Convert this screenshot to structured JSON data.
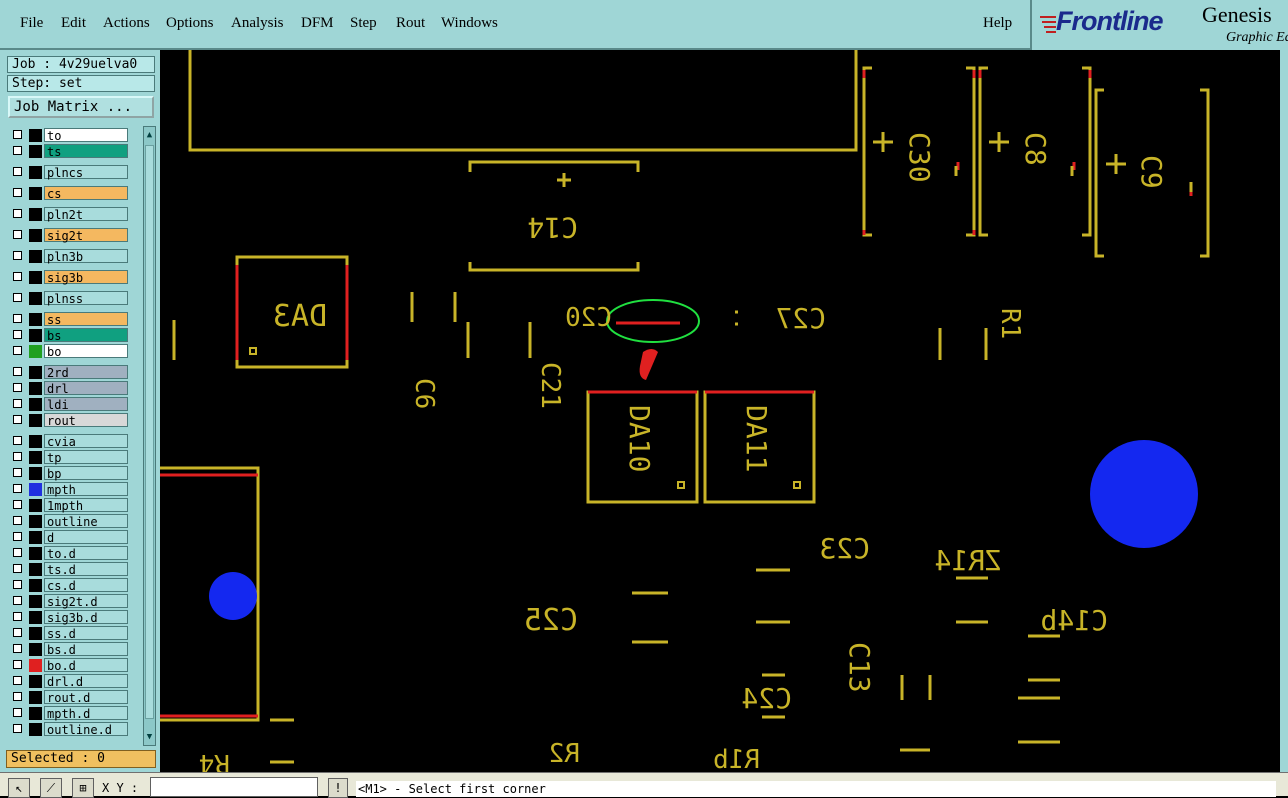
{
  "menu": [
    "File",
    "Edit",
    "Actions",
    "Options",
    "Analysis",
    "DFM",
    "Step",
    "Rout",
    "Windows"
  ],
  "help": "Help",
  "brand": {
    "logo": "Frontline",
    "product": "Genesis",
    "sub": "Graphic Ed"
  },
  "job": "Job : 4v29uelva0",
  "step": "Step: set",
  "job_matrix": "Job Matrix ...",
  "layers": [
    {
      "name": "to",
      "bg": "#ffffff",
      "swatch": "#000000"
    },
    {
      "name": "ts",
      "bg": "#10a080",
      "swatch": "#000000"
    },
    {
      "name": "plncs",
      "bg": "#a8dcdc",
      "swatch": "#000000"
    },
    {
      "name": "cs",
      "bg": "#f4b860",
      "swatch": "#000000"
    },
    {
      "name": "pln2t",
      "bg": "#a8dcdc",
      "swatch": "#000000"
    },
    {
      "name": "sig2t",
      "bg": "#f4b860",
      "swatch": "#000000"
    },
    {
      "name": "pln3b",
      "bg": "#a8dcdc",
      "swatch": "#000000"
    },
    {
      "name": "sig3b",
      "bg": "#f4b860",
      "swatch": "#000000"
    },
    {
      "name": "plnss",
      "bg": "#a8dcdc",
      "swatch": "#000000"
    },
    {
      "name": "ss",
      "bg": "#f4b860",
      "swatch": "#000000"
    },
    {
      "name": "bs",
      "bg": "#10a080",
      "swatch": "#000000"
    },
    {
      "name": "bo",
      "bg": "#ffffff",
      "swatch": "#20a020"
    },
    {
      "name": "2rd",
      "bg": "#a0b0c0",
      "swatch": "#000000"
    },
    {
      "name": "drl",
      "bg": "#a0b0c0",
      "swatch": "#000000"
    },
    {
      "name": "ldi",
      "bg": "#a0b0c0",
      "swatch": "#000000"
    },
    {
      "name": "rout",
      "bg": "#d8d8d8",
      "swatch": "#000000"
    },
    {
      "name": "cvia",
      "bg": "#a8dcdc",
      "swatch": "#000000"
    },
    {
      "name": "tp",
      "bg": "#a8dcdc",
      "swatch": "#000000"
    },
    {
      "name": "bp",
      "bg": "#a8dcdc",
      "swatch": "#000000"
    },
    {
      "name": "mpth",
      "bg": "#a8dcdc",
      "swatch": "#2030e0"
    },
    {
      "name": "1mpth",
      "bg": "#a8dcdc",
      "swatch": "#000000"
    },
    {
      "name": "outline",
      "bg": "#a8dcdc",
      "swatch": "#000000"
    },
    {
      "name": "d",
      "bg": "#a8dcdc",
      "swatch": "#000000"
    },
    {
      "name": "to.d",
      "bg": "#a8dcdc",
      "swatch": "#000000"
    },
    {
      "name": "ts.d",
      "bg": "#a8dcdc",
      "swatch": "#000000"
    },
    {
      "name": "cs.d",
      "bg": "#a8dcdc",
      "swatch": "#000000"
    },
    {
      "name": "sig2t.d",
      "bg": "#a8dcdc",
      "swatch": "#000000"
    },
    {
      "name": "sig3b.d",
      "bg": "#a8dcdc",
      "swatch": "#000000"
    },
    {
      "name": "ss.d",
      "bg": "#a8dcdc",
      "swatch": "#000000"
    },
    {
      "name": "bs.d",
      "bg": "#a8dcdc",
      "swatch": "#000000"
    },
    {
      "name": "bo.d",
      "bg": "#a8dcdc",
      "swatch": "#e02020"
    },
    {
      "name": "drl.d",
      "bg": "#a8dcdc",
      "swatch": "#000000"
    },
    {
      "name": "rout.d",
      "bg": "#a8dcdc",
      "swatch": "#000000"
    },
    {
      "name": "mpth.d",
      "bg": "#a8dcdc",
      "swatch": "#000000"
    },
    {
      "name": "outline.d",
      "bg": "#a8dcdc",
      "swatch": "#000000"
    }
  ],
  "selected": "Selected : 0",
  "xy_label": "X Y :",
  "bang": "!",
  "status": "<M1> - Select first corner",
  "designators": [
    "DA3",
    "C14",
    "C20",
    "C21",
    "C27",
    "C6",
    "DA10",
    "DA11",
    "C23",
    "C25",
    "C24",
    "C13",
    "C30",
    "C8",
    "C9",
    "R4",
    "R2",
    "R1",
    "R1b",
    "ZR14",
    "C14b"
  ],
  "colors": {
    "outline": "#c8b428",
    "pad": "#e02020",
    "silk": "#c8b428",
    "via": "#1428f0",
    "highlight": "#20e040"
  }
}
